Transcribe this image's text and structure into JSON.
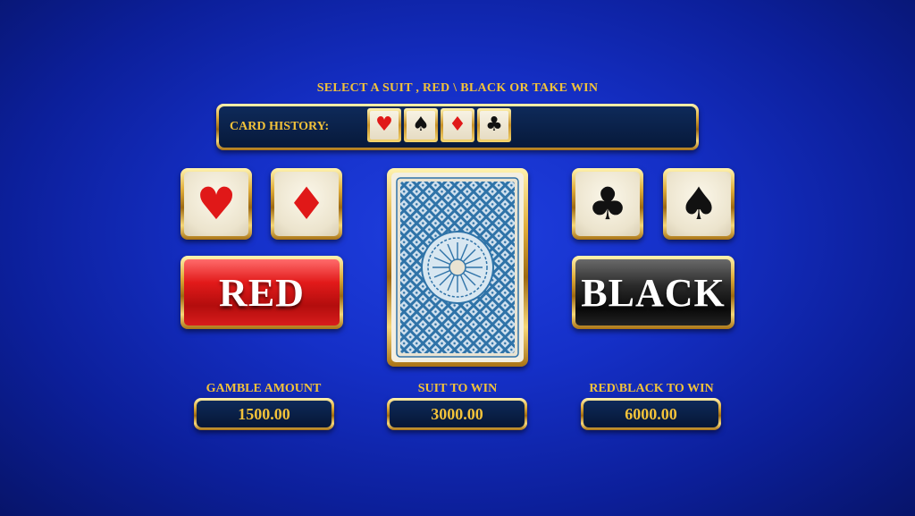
{
  "instruction": "SELECT A SUIT , RED \\ BLACK OR TAKE WIN",
  "history": {
    "label": "CARD HISTORY:",
    "cards": [
      {
        "suit": "heart-icon",
        "glyph": "♥",
        "color": "red"
      },
      {
        "suit": "spade-icon",
        "glyph": "♠",
        "color": "black"
      },
      {
        "suit": "diamond-icon",
        "glyph": "♦",
        "color": "red"
      },
      {
        "suit": "club-icon",
        "glyph": "♣",
        "color": "black"
      }
    ]
  },
  "suits": {
    "heart": "♥",
    "diamond": "♦",
    "club": "♣",
    "spade": "♠"
  },
  "buttons": {
    "red": "RED",
    "black": "BLACK"
  },
  "stats": {
    "gamble_label": "GAMBLE AMOUNT",
    "gamble_value": "1500.00",
    "suit_label": "SUIT TO WIN",
    "suit_value": "3000.00",
    "color_label": "RED\\BLACK TO WIN",
    "color_value": "6000.00"
  },
  "colors": {
    "gold": "#f2c23a",
    "suit_red": "#e01818",
    "background_blue": "#1530c8"
  }
}
